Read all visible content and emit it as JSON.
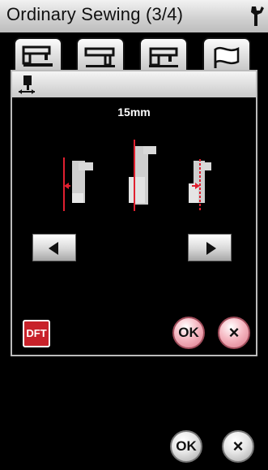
{
  "window": {
    "title": "Ordinary Sewing (3/4)",
    "settings_icon": "wrench-icon"
  },
  "tabs": [
    {
      "icon": "sewing-machine-icon",
      "active": true
    },
    {
      "icon": "presser-foot-icon",
      "active": false
    },
    {
      "icon": "machine-side-icon",
      "active": false
    },
    {
      "icon": "flag-icon",
      "active": false
    }
  ],
  "dialog": {
    "header_icon": "needle-position-icon",
    "value": "15mm",
    "left_button_icon": "arrow-left-icon",
    "right_button_icon": "arrow-right-icon",
    "default_label": "DFT",
    "ok_label": "OK",
    "cancel_label": "×"
  },
  "footer": {
    "ok_label": "OK",
    "cancel_label": "×"
  },
  "colors": {
    "accent_red": "#d0202a",
    "ok_pink": "#f2a9b6",
    "titlebar": "#d9d9d9"
  }
}
